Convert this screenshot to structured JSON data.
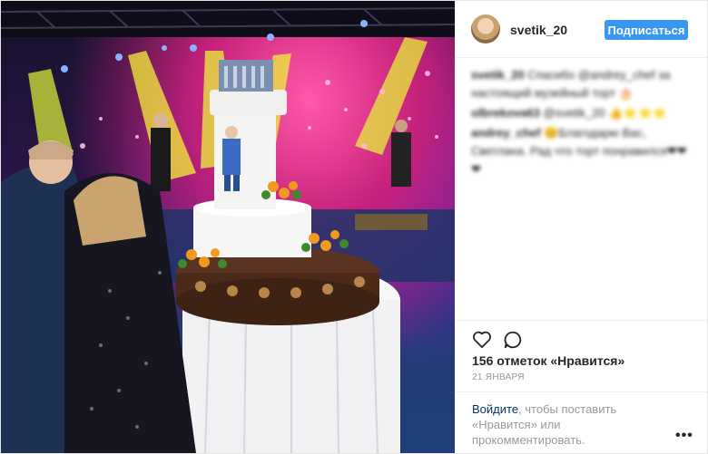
{
  "header": {
    "username": "svetik_20",
    "follow_label": "Подписаться"
  },
  "comments": [
    {
      "author": "svetik_20",
      "text": "Спасибо @andrey_chef за настоящий музейный торт 🎂"
    },
    {
      "author": "olbrekova63",
      "text": "@svetik_20 👍⭐⭐⭐"
    },
    {
      "author": "andrey_chef",
      "text": "😊Благодарю Вас, Светлана. Рад что торт понравился❤❤❤"
    }
  ],
  "likes": {
    "text": "156 отметок «Нравится»"
  },
  "date": "21 ЯНВАРЯ",
  "login": {
    "link": "Войдите",
    "rest": ", чтобы поставить «Нравится» или прокомментировать."
  },
  "more": "•••",
  "icons": {
    "like": "heart-icon",
    "comment": "comment-bubble-icon",
    "more": "more-options-icon"
  },
  "colors": {
    "follow_button": "#3897f0",
    "login_link": "#003569",
    "muted_text": "#999999"
  }
}
